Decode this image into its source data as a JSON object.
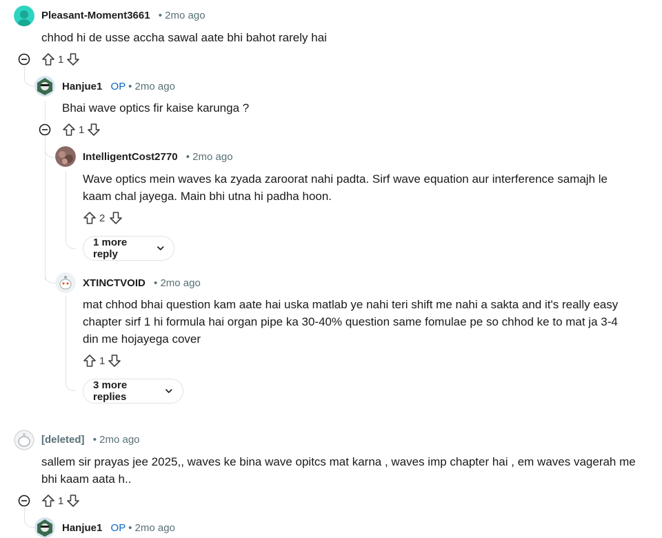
{
  "comments": [
    {
      "author": "Pleasant-Moment3661",
      "time": "2mo ago",
      "text": "chhod hi de usse accha sawal aate bhi bahot rarely hai",
      "votes": "1"
    },
    {
      "author": "Hanjue1",
      "op": "OP",
      "time": "2mo ago",
      "text": "Bhai wave optics fir kaise karunga ?",
      "votes": "1"
    },
    {
      "author": "IntelligentCost2770",
      "time": "2mo ago",
      "lines": [
        "Wave optics mein waves ka zyada zaroorat nahi padta. Sirf wave equation aur interference samajh le",
        "kaam chal jayega. Main bhi utna hi padha hoon."
      ],
      "votes": "2",
      "more": "1 more reply"
    },
    {
      "author": "XTINCTVOID",
      "time": "2mo ago",
      "lines": [
        "mat chhod bhai question kam aate hai uska matlab ye nahi teri shift me nahi a sakta and it's really easy",
        "chapter sirf 1 hi formula hai organ pipe ka 30-40% question same fomulae pe so chhod ke to mat ja 3-4",
        "din me hojayega cover"
      ],
      "votes": "1",
      "more": "3 more replies"
    },
    {
      "author": "[deleted]",
      "time": "2mo ago",
      "lines": [
        "sallem sir prayas jee 2025,, waves ke bina wave opitcs mat karna , waves imp chapter hai , em waves vagerah me",
        "bhi kaam aata h.."
      ],
      "votes": "1"
    },
    {
      "author": "Hanjue1",
      "op": "OP",
      "time": "2mo ago"
    }
  ],
  "sep": "•",
  "colors": {
    "op": "#0a66c2",
    "meta": "#576f76",
    "thread": "#dfe3e5",
    "avatar_teal": "#2dd4bf"
  },
  "icons": [
    "reddit-avatar-icon",
    "upvote-icon",
    "downvote-icon",
    "collapse-icon",
    "chevron-down-icon"
  ]
}
